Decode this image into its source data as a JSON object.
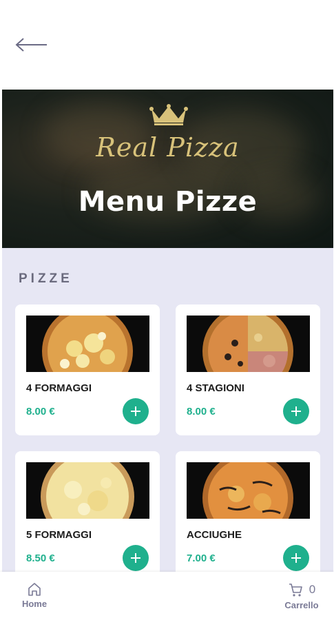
{
  "hero": {
    "brand": "Real Pizza",
    "title": "Menu Pizze"
  },
  "section": {
    "title": "PIZZE"
  },
  "products": [
    {
      "name": "4 FORMAGGI",
      "price": "8.00 €"
    },
    {
      "name": "4 STAGIONI",
      "price": "8.00 €"
    },
    {
      "name": "5 FORMAGGI",
      "price": "8.50 €"
    },
    {
      "name": "ACCIUGHE",
      "price": "7.00 €"
    }
  ],
  "bottom_nav": {
    "home_label": "Home",
    "cart_label": "Carrello",
    "cart_count": "0"
  },
  "colors": {
    "accent": "#1fb08d",
    "content_bg": "#e7e7f4",
    "nav_text": "#7a7a96",
    "brand_gold": "#d8c27a"
  },
  "icons": {
    "back": "arrow-left-icon",
    "crown": "crown-icon",
    "add": "plus-icon",
    "home": "home-icon",
    "cart": "cart-icon"
  }
}
